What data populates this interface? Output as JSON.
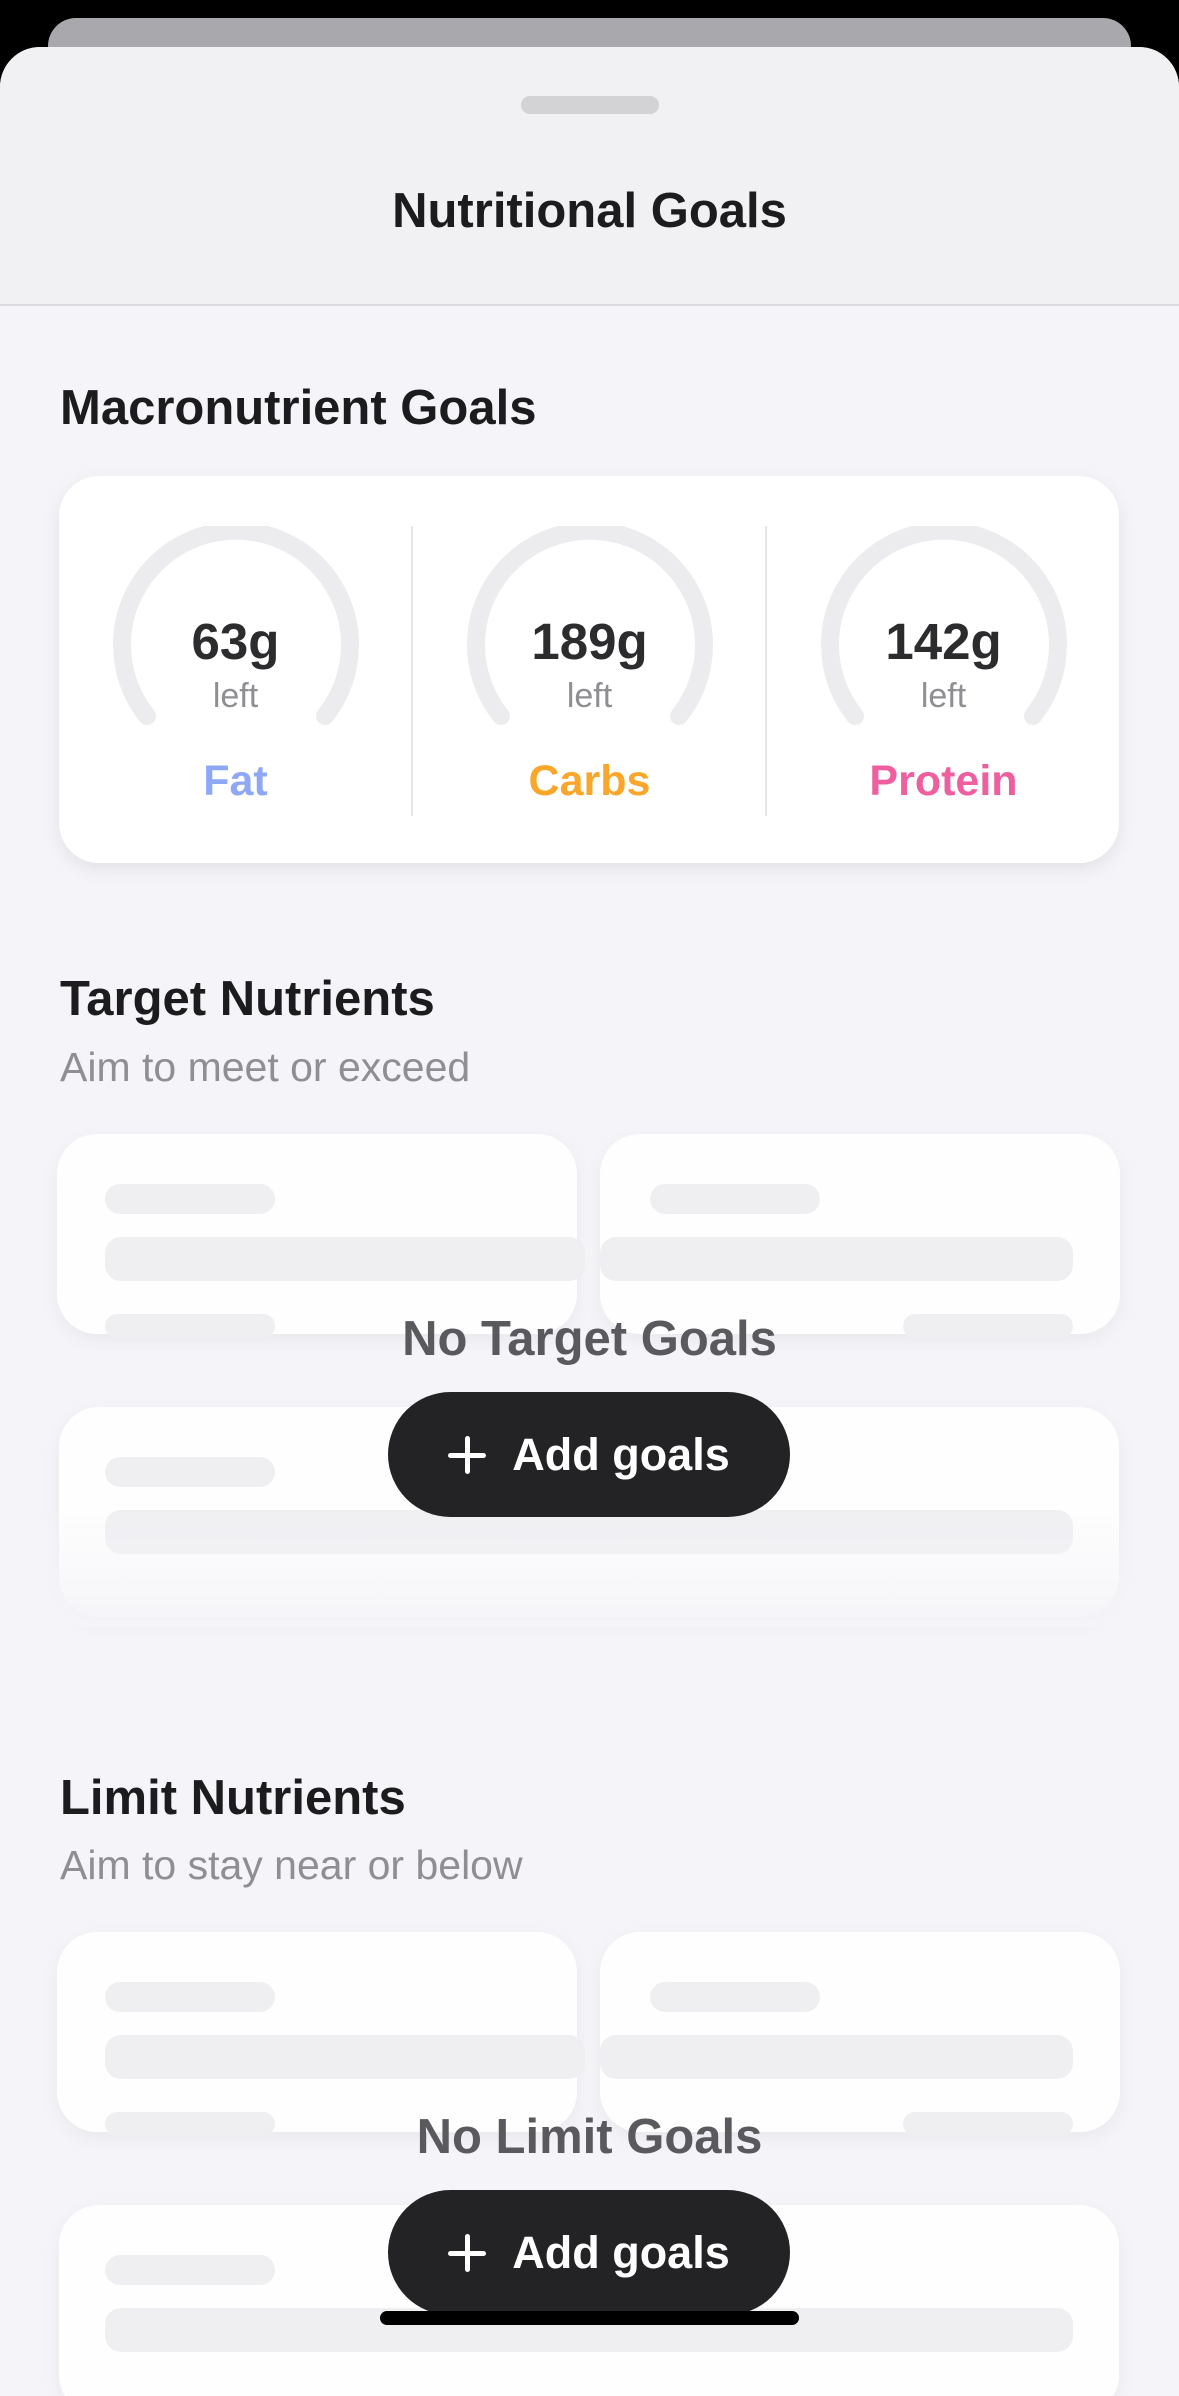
{
  "sheet": {
    "title": "Nutritional Goals"
  },
  "macros": {
    "title": "Macronutrient Goals",
    "items": [
      {
        "value": "63g",
        "unit_label": "left",
        "name": "Fat",
        "color": "#8fa8f6",
        "fill_fraction": 0
      },
      {
        "value": "189g",
        "unit_label": "left",
        "name": "Carbs",
        "color": "#f9a62b",
        "fill_fraction": 0
      },
      {
        "value": "142g",
        "unit_label": "left",
        "name": "Protein",
        "color": "#ef5fa0",
        "fill_fraction": 0
      }
    ],
    "track_color": "#ececef"
  },
  "target": {
    "title": "Target Nutrients",
    "subtitle": "Aim to meet or exceed",
    "empty_label": "No Target Goals",
    "button_label": "Add goals"
  },
  "limit": {
    "title": "Limit Nutrients",
    "subtitle": "Aim to stay near or below",
    "empty_label": "No Limit Goals",
    "button_label": "Add goals"
  },
  "icons": {
    "add": "plus-icon"
  }
}
